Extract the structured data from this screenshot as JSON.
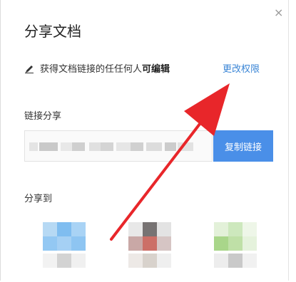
{
  "dialog": {
    "title": "分享文档",
    "close_glyph": "×"
  },
  "permission": {
    "prefix": "获得文档链接的任任何人",
    "mode": "可编辑",
    "change_label": "更改权限"
  },
  "link_share": {
    "label": "链接分享",
    "copy_label": "复制链接"
  },
  "share_to": {
    "label": "分享到"
  },
  "colors": {
    "accent": "#4a8fe8",
    "link": "#3b86d6",
    "arrow": "#e8262a"
  }
}
